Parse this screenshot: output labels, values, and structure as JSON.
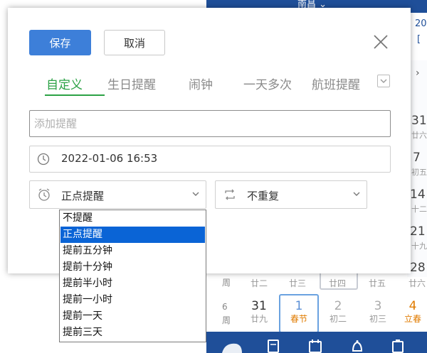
{
  "background": {
    "city": "南昌 ⌄",
    "year_frag": "20",
    "year_frag2": "[",
    "week_label": "周",
    "side_dates": [
      {
        "num": "31",
        "lunar": "廿六"
      },
      {
        "num": "7",
        "lunar": "初五"
      },
      {
        "num": "14",
        "lunar": "十二"
      },
      {
        "num": "21",
        "lunar": "十九"
      },
      {
        "num": "28",
        "lunar": "廿六"
      }
    ],
    "prev_row": [
      "廿二",
      "廿三",
      "廿四",
      "廿五",
      "廿六"
    ],
    "week_number": "6",
    "calendar_row": [
      {
        "num": "31",
        "lunar": "廿九"
      },
      {
        "num": "1",
        "lunar": "春节"
      },
      {
        "num": "2",
        "lunar": "初二"
      },
      {
        "num": "3",
        "lunar": "初三"
      },
      {
        "num": "4",
        "lunar": "立春"
      }
    ]
  },
  "dialog": {
    "save_label": "保存",
    "cancel_label": "取消",
    "tabs": [
      "自定义",
      "生日提醒",
      "闹钟",
      "一天多次",
      "航班提醒"
    ],
    "title_placeholder": "添加提醒",
    "datetime": "2022-01-06 16:53",
    "remind_select": "正点提醒",
    "repeat_select": "不重复",
    "remind_options": [
      "不提醒",
      "正点提醒",
      "提前五分钟",
      "提前十分钟",
      "提前半小时",
      "提前一小时",
      "提前一天",
      "提前三天"
    ],
    "selected_option": "正点提醒"
  },
  "colors": {
    "accent_blue": "#3d7fd9",
    "tab_green": "#2ba245",
    "selection_blue": "#0a64d6",
    "app_navy": "#1f4f99",
    "holiday_orange": "#e07b00"
  }
}
